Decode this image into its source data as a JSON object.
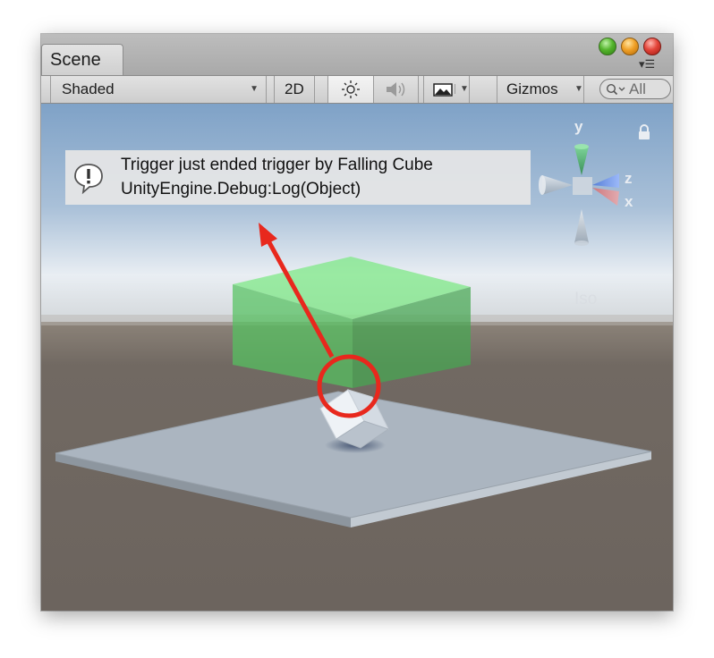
{
  "window": {
    "tab_title": "Scene"
  },
  "toolbar": {
    "shading_mode": "Shaded",
    "mode_2d": "2D",
    "gizmos_label": "Gizmos",
    "search_placeholder": "All"
  },
  "console_message": {
    "line1": "Trigger just ended trigger by Falling Cube",
    "line2": "UnityEngine.Debug:Log(Object)"
  },
  "orientation_gizmo": {
    "axis_y": "y",
    "axis_z": "z",
    "axis_x": "x",
    "projection_label": "Iso"
  },
  "colors": {
    "trigger_volume": "#5fd66a",
    "annotation": "#e8281d",
    "floor": "#aab3bd",
    "ground": "#6e6660"
  }
}
